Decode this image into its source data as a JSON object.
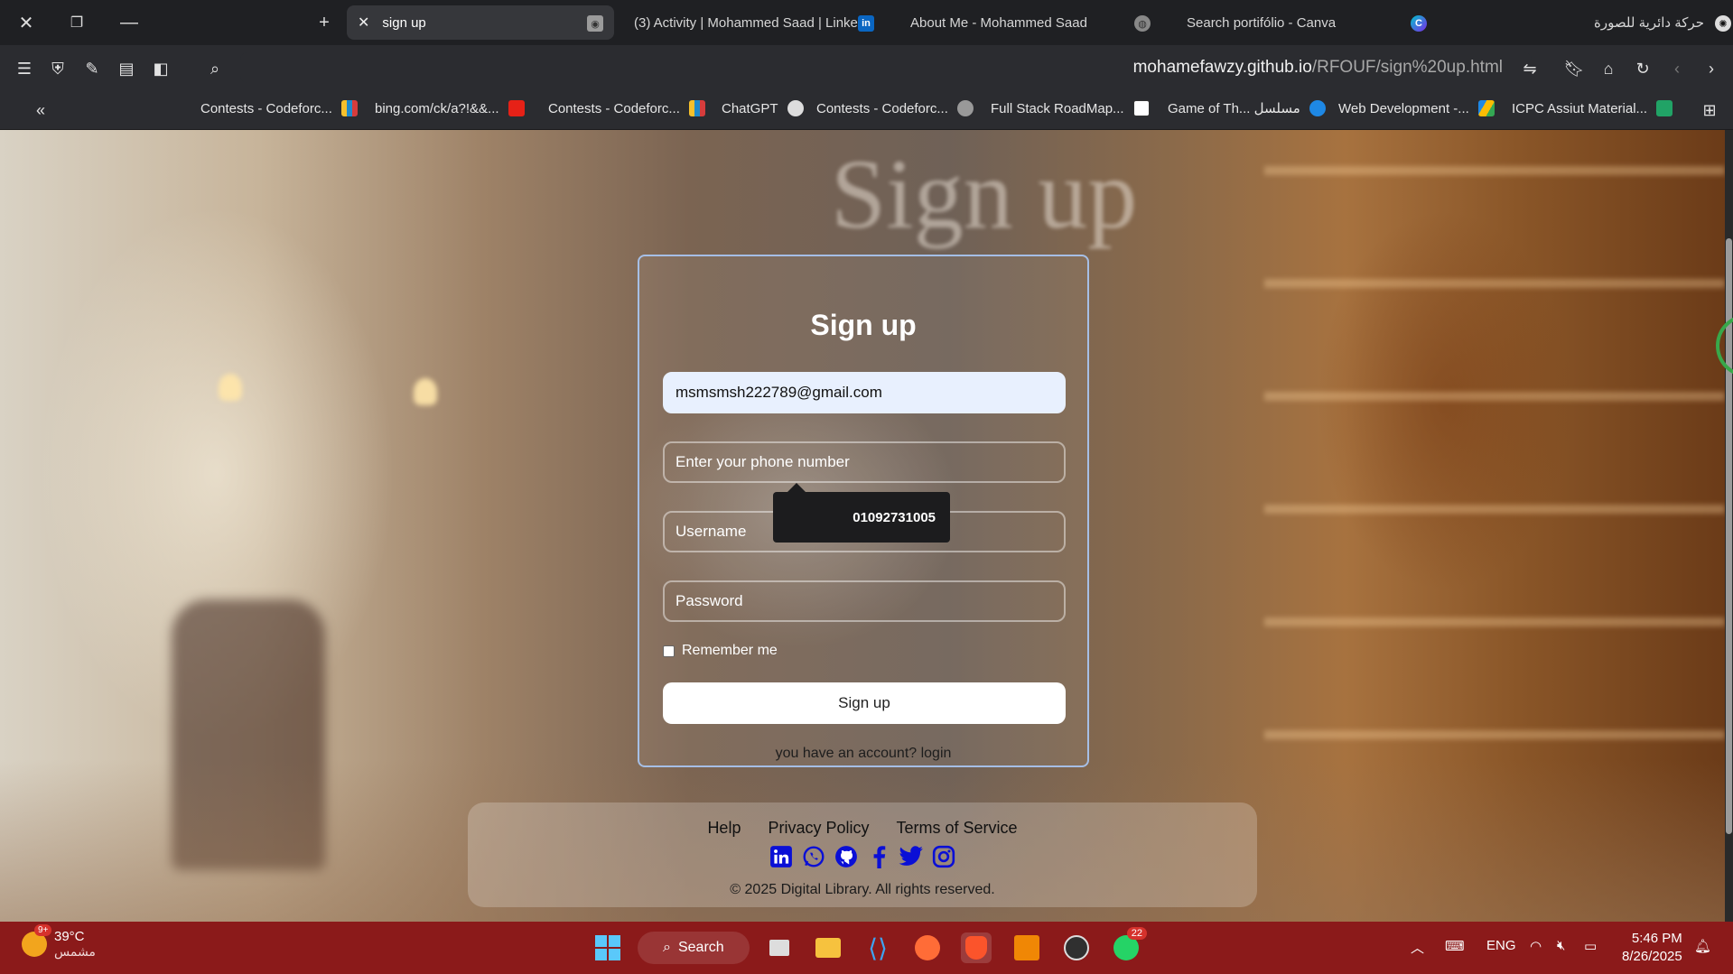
{
  "browser": {
    "tabs": [
      {
        "label": "sign up",
        "active": true
      },
      {
        "label": "(3) Activity | Mohammed Saad | Linke"
      },
      {
        "label": "About Me - Mohammed Saad"
      },
      {
        "label": "Search portifólio - Canva"
      },
      {
        "label": "حركة دائرية للصورة"
      }
    ],
    "url_host": "mohamefawzy.github.io",
    "url_path": "/RFOUF/sign%20up.html",
    "bookmarks": [
      "Contests - Codeforc...",
      "bing.com/ck/a?!&&...",
      "Contests - Codeforc...",
      "ChatGPT",
      "Contests - Codeforc...",
      "Full Stack RoadMap...",
      "Game of Th... مسلسل",
      "Web Development -...",
      "ICPC Assiut Material..."
    ]
  },
  "page": {
    "background_title": "Sign up",
    "form": {
      "title": "Sign up",
      "email_value": "msmsmsh222789@gmail.com",
      "phone_placeholder": "Enter your phone number",
      "username_placeholder": "Username",
      "password_placeholder": "Password",
      "remember_label": "Remember me",
      "submit_label": "Sign up",
      "login_text": "you have an account? login"
    },
    "autofill_tooltip": "01092731005",
    "footer": {
      "links": [
        "Help",
        "Privacy Policy",
        "Terms of Service"
      ],
      "socials": [
        "linkedin-icon",
        "whatsapp-icon",
        "github-icon",
        "facebook-icon",
        "twitter-icon",
        "instagram-icon"
      ],
      "copyright": "© 2025 Digital Library. All rights reserved."
    }
  },
  "taskbar": {
    "weather_temp": "39°C",
    "weather_desc": "مشمس",
    "weather_badge": "9+",
    "search_label": "Search",
    "whatsapp_badge": "22",
    "lang": "ENG",
    "time": "5:46 PM",
    "date": "8/26/2025"
  },
  "colors": {
    "taskbar": "#8b1a1a",
    "panel_border": "#aac8f5",
    "social_blue": "#0a0fd6"
  }
}
